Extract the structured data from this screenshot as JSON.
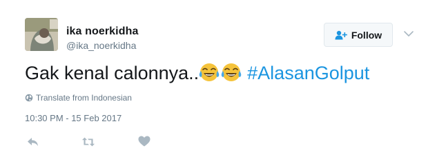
{
  "user": {
    "fullname": "ika noerkidha",
    "username": "@ika_noerkidha"
  },
  "follow_button": {
    "label": "Follow"
  },
  "tweet": {
    "text": "Gak kenal calonnya..",
    "emojis": [
      "face-with-tears-of-joy",
      "face-with-tears-of-joy"
    ],
    "hashtag": "#AlasanGolput"
  },
  "translate": {
    "label": "Translate from Indonesian"
  },
  "timestamp": "10:30 PM - 15 Feb 2017",
  "actions": [
    "reply-icon",
    "retweet-icon",
    "like-icon"
  ],
  "colors": {
    "hashtag": "#1b95e0",
    "secondary_text": "#657786",
    "action_icon": "#aab8c2"
  }
}
